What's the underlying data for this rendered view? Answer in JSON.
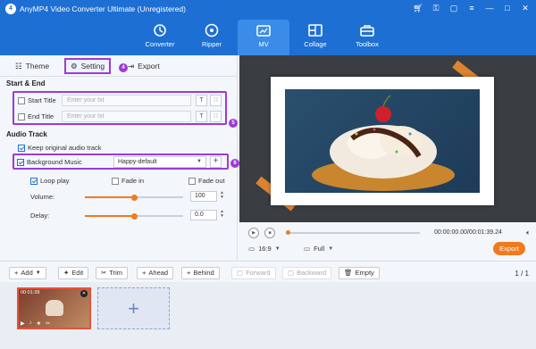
{
  "app": {
    "title": "AnyMP4 Video Converter Ultimate (Unregistered)"
  },
  "nav": {
    "items": [
      {
        "label": "Converter",
        "icon": "converter-icon"
      },
      {
        "label": "Ripper",
        "icon": "ripper-icon"
      },
      {
        "label": "MV",
        "icon": "mv-icon",
        "active": true
      },
      {
        "label": "Collage",
        "icon": "collage-icon"
      },
      {
        "label": "Toolbox",
        "icon": "toolbox-icon"
      }
    ]
  },
  "tabs": {
    "theme": "Theme",
    "setting": "Setting",
    "export": "Export"
  },
  "start_end": {
    "heading": "Start & End",
    "start_title": {
      "label": "Start Title",
      "placeholder": "Enter your txt"
    },
    "end_title": {
      "label": "End Title",
      "placeholder": "Enter your txt"
    }
  },
  "audio": {
    "heading": "Audio Track",
    "keep_original": "Keep original audio track",
    "background_music": "Background Music",
    "music_selected": "Happy-default",
    "loop_play": "Loop play",
    "fade_in": "Fade in",
    "fade_out": "Fade out",
    "volume_label": "Volume:",
    "volume_value": "100",
    "volume_level": 0.5,
    "delay_label": "Delay:",
    "delay_value": "0.0",
    "delay_level": 0.5
  },
  "badges": {
    "b1": "4",
    "b2": "5",
    "b3": "6"
  },
  "player": {
    "time": "00:00:00.00/00:01:39.24",
    "aspect": "16:9",
    "fit": "Full",
    "export_label": "Export"
  },
  "toolbar": {
    "add": "Add",
    "edit": "Edit",
    "trim": "Trim",
    "ahead": "Ahead",
    "behind": "Behind",
    "forward": "Forward",
    "backward": "Backward",
    "empty": "Empty",
    "page": "1 / 1"
  },
  "clip": {
    "duration": "00:01:39"
  },
  "colors": {
    "accent": "#1e6fd4",
    "highlight": "#9b3bd6",
    "orange": "#f07a1e"
  }
}
